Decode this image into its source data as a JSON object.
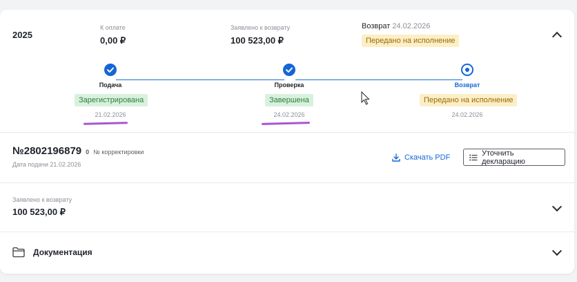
{
  "summary": {
    "year": "2025",
    "to_pay_label": "К оплате",
    "to_pay_value": "0,00 ₽",
    "claimed_label": "Заявлено к возврату",
    "claimed_value": "100 523,00 ₽",
    "refund_label": "Возврат",
    "refund_date": "24.02.2026",
    "refund_status": "Передано на исполнение"
  },
  "steps": [
    {
      "title": "Подача",
      "status": "Зарегистрирована",
      "date": "21.02.2026",
      "state": "done"
    },
    {
      "title": "Проверка",
      "status": "Завершена",
      "date": "24.02.2026",
      "state": "done"
    },
    {
      "title": "Возврат",
      "status": "Передано на исполнение",
      "date": "24.02.2026",
      "state": "active"
    }
  ],
  "declaration": {
    "number": "№2802196879",
    "correction_count": "0",
    "correction_label": "№ корректировки",
    "submit_date": "Дата подачи 21.02.2026",
    "download_label": "Скачать PDF",
    "clarify_label": "Уточнить декларацию"
  },
  "refund_section": {
    "label": "Заявлено к возврату",
    "value": "100 523,00 ₽"
  },
  "docs_section": {
    "label": "Документация"
  },
  "colors": {
    "accent": "#1466d6",
    "underline": "#a855d6"
  }
}
